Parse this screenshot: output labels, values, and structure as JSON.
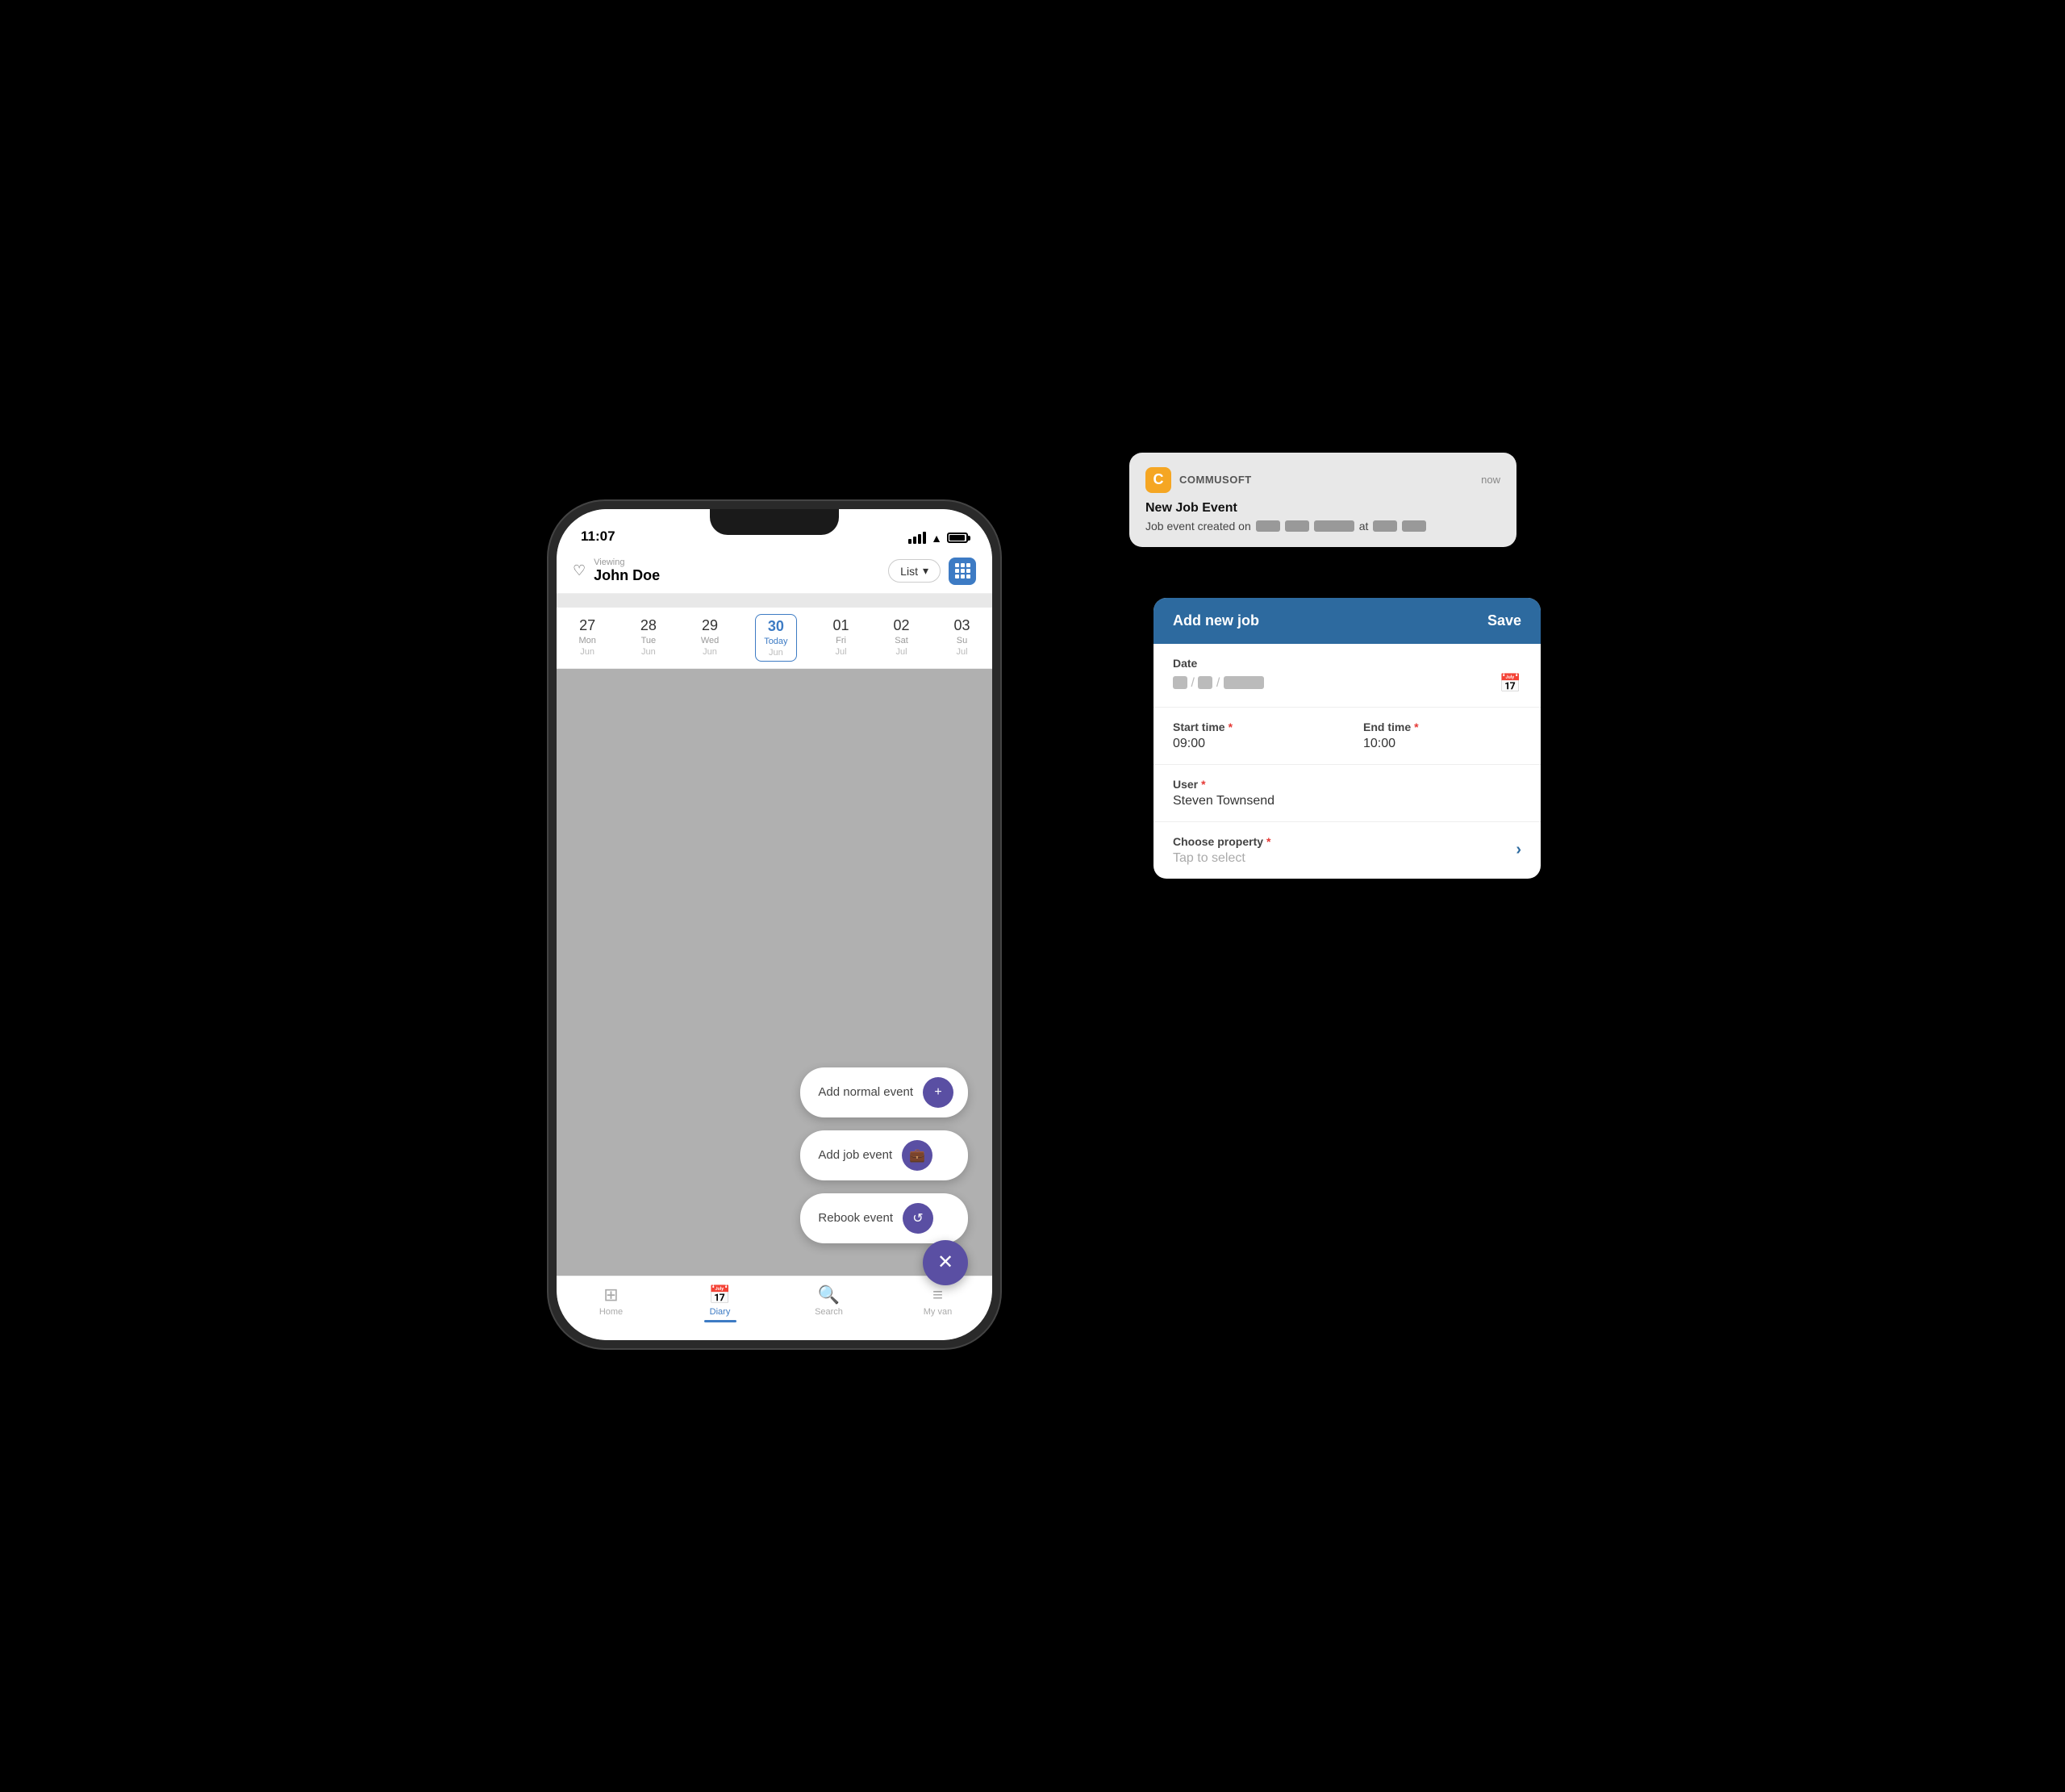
{
  "status_bar": {
    "time": "11:07"
  },
  "header": {
    "viewing_label": "Viewing",
    "user_name": "John Doe",
    "list_toggle": "List",
    "grid_icon": "grid-icon"
  },
  "calendar": {
    "days": [
      {
        "num": "27",
        "name": "Mon",
        "month": "Jun",
        "today": false
      },
      {
        "num": "28",
        "name": "Tue",
        "month": "Jun",
        "today": false
      },
      {
        "num": "29",
        "name": "Wed",
        "month": "Jun",
        "today": false
      },
      {
        "num": "30",
        "name": "Today",
        "month": "Jun",
        "today": true
      },
      {
        "num": "01",
        "name": "Fri",
        "month": "Jul",
        "today": false
      },
      {
        "num": "02",
        "name": "Sat",
        "month": "Jul",
        "today": false
      },
      {
        "num": "03",
        "name": "Su",
        "month": "Jul",
        "today": false
      }
    ]
  },
  "action_buttons": [
    {
      "label": "Add normal event",
      "icon": "+"
    },
    {
      "label": "Add job event",
      "icon": "💼"
    },
    {
      "label": "Rebook event",
      "icon": "↺"
    }
  ],
  "bottom_nav": [
    {
      "label": "Home",
      "icon": "⊞",
      "active": false
    },
    {
      "label": "Diary",
      "icon": "📅",
      "active": true
    },
    {
      "label": "Search",
      "icon": "🔍",
      "active": false
    },
    {
      "label": "My van",
      "icon": "≡",
      "active": false
    }
  ],
  "notification": {
    "app_name": "COMMUSOFT",
    "app_icon": "C",
    "time": "now",
    "title": "New Job Event",
    "body_prefix": "Job event created on",
    "body_suffix": "at"
  },
  "job_panel": {
    "title": "Add new job",
    "save_label": "Save",
    "date_label": "Date",
    "start_time_label": "Start time",
    "start_time_value": "09:00",
    "end_time_label": "End time",
    "end_time_value": "10:00",
    "user_label": "User",
    "user_value": "Steven Townsend",
    "property_label": "Choose property",
    "property_placeholder": "Tap to select"
  }
}
